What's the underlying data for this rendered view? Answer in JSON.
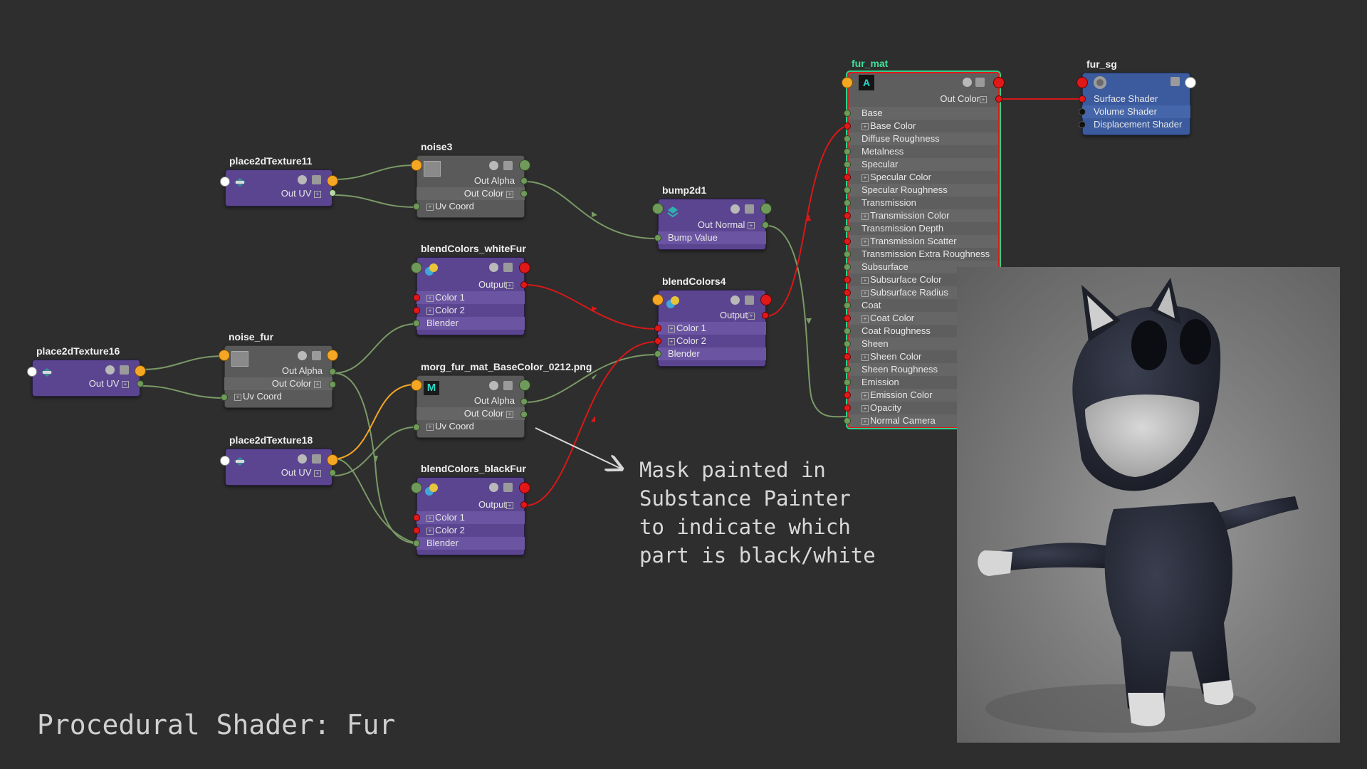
{
  "page": {
    "title": "Procedural Shader: Fur"
  },
  "annotation": {
    "text": "Mask painted in\nSubstance Painter\nto indicate which\npart is black/white"
  },
  "colors": {
    "background": "#2e2e2e",
    "utility_node": "#5b4590",
    "shading_group": "#3b5b9e",
    "wire_green": "#7a9a66",
    "wire_red": "#d81818",
    "wire_orange": "#f5a623"
  },
  "nodes": {
    "place2dTexture11": {
      "title": "place2dTexture11",
      "ports": [
        "Out UV"
      ],
      "icon": "place2d-icon"
    },
    "place2dTexture16": {
      "title": "place2dTexture16",
      "ports": [
        "Out UV"
      ],
      "icon": "place2d-icon"
    },
    "place2dTexture18": {
      "title": "place2dTexture18",
      "ports": [
        "Out UV"
      ],
      "icon": "place2d-icon"
    },
    "noise3": {
      "title": "noise3",
      "ports": [
        "Out Alpha",
        "Out Color",
        "Uv Coord"
      ],
      "icon": "noise-icon"
    },
    "noise_fur": {
      "title": "noise_fur",
      "ports": [
        "Out Alpha",
        "Out Color",
        "Uv Coord"
      ],
      "icon": "noise-icon"
    },
    "blendColors_whiteFur": {
      "title": "blendColors_whiteFur",
      "ports": [
        "Output",
        "Color 1",
        "Color 2",
        "Blender"
      ],
      "icon": "blend-colors-icon"
    },
    "blendColors_blackFur": {
      "title": "blendColors_blackFur",
      "ports": [
        "Output",
        "Color 1",
        "Color 2",
        "Blender"
      ],
      "icon": "blend-colors-icon"
    },
    "blendColors4": {
      "title": "blendColors4",
      "ports": [
        "Output",
        "Color 1",
        "Color 2",
        "Blender"
      ],
      "icon": "blend-colors-icon"
    },
    "file": {
      "title": "morg_fur_mat_BaseColor_0212.png",
      "ports": [
        "Out Alpha",
        "Out Color",
        "Uv Coord"
      ],
      "icon": "file-texture-icon"
    },
    "bump2d1": {
      "title": "bump2d1",
      "ports": [
        "Out Normal",
        "Bump Value"
      ],
      "icon": "bump-icon"
    },
    "fur_mat": {
      "title": "fur_mat",
      "out_port": "Out Color",
      "attributes": [
        "Base",
        "Base Color",
        "Diffuse Roughness",
        "Metalness",
        "Specular",
        "Specular Color",
        "Specular Roughness",
        "Transmission",
        "Transmission Color",
        "Transmission Depth",
        "Transmission Scatter",
        "Transmission Extra Roughness",
        "Subsurface",
        "Subsurface Color",
        "Subsurface Radius",
        "Coat",
        "Coat Color",
        "Coat Roughness",
        "Sheen",
        "Sheen Color",
        "Sheen Roughness",
        "Emission",
        "Emission Color",
        "Opacity",
        "Normal Camera"
      ],
      "icon": "arnold-icon"
    },
    "fur_sg": {
      "title": "fur_sg",
      "ports": [
        "Surface Shader",
        "Volume Shader",
        "Displacement Shader"
      ],
      "icon": "shading-group-icon"
    }
  },
  "render": {
    "subject": "cartoon-cat-render-image"
  }
}
